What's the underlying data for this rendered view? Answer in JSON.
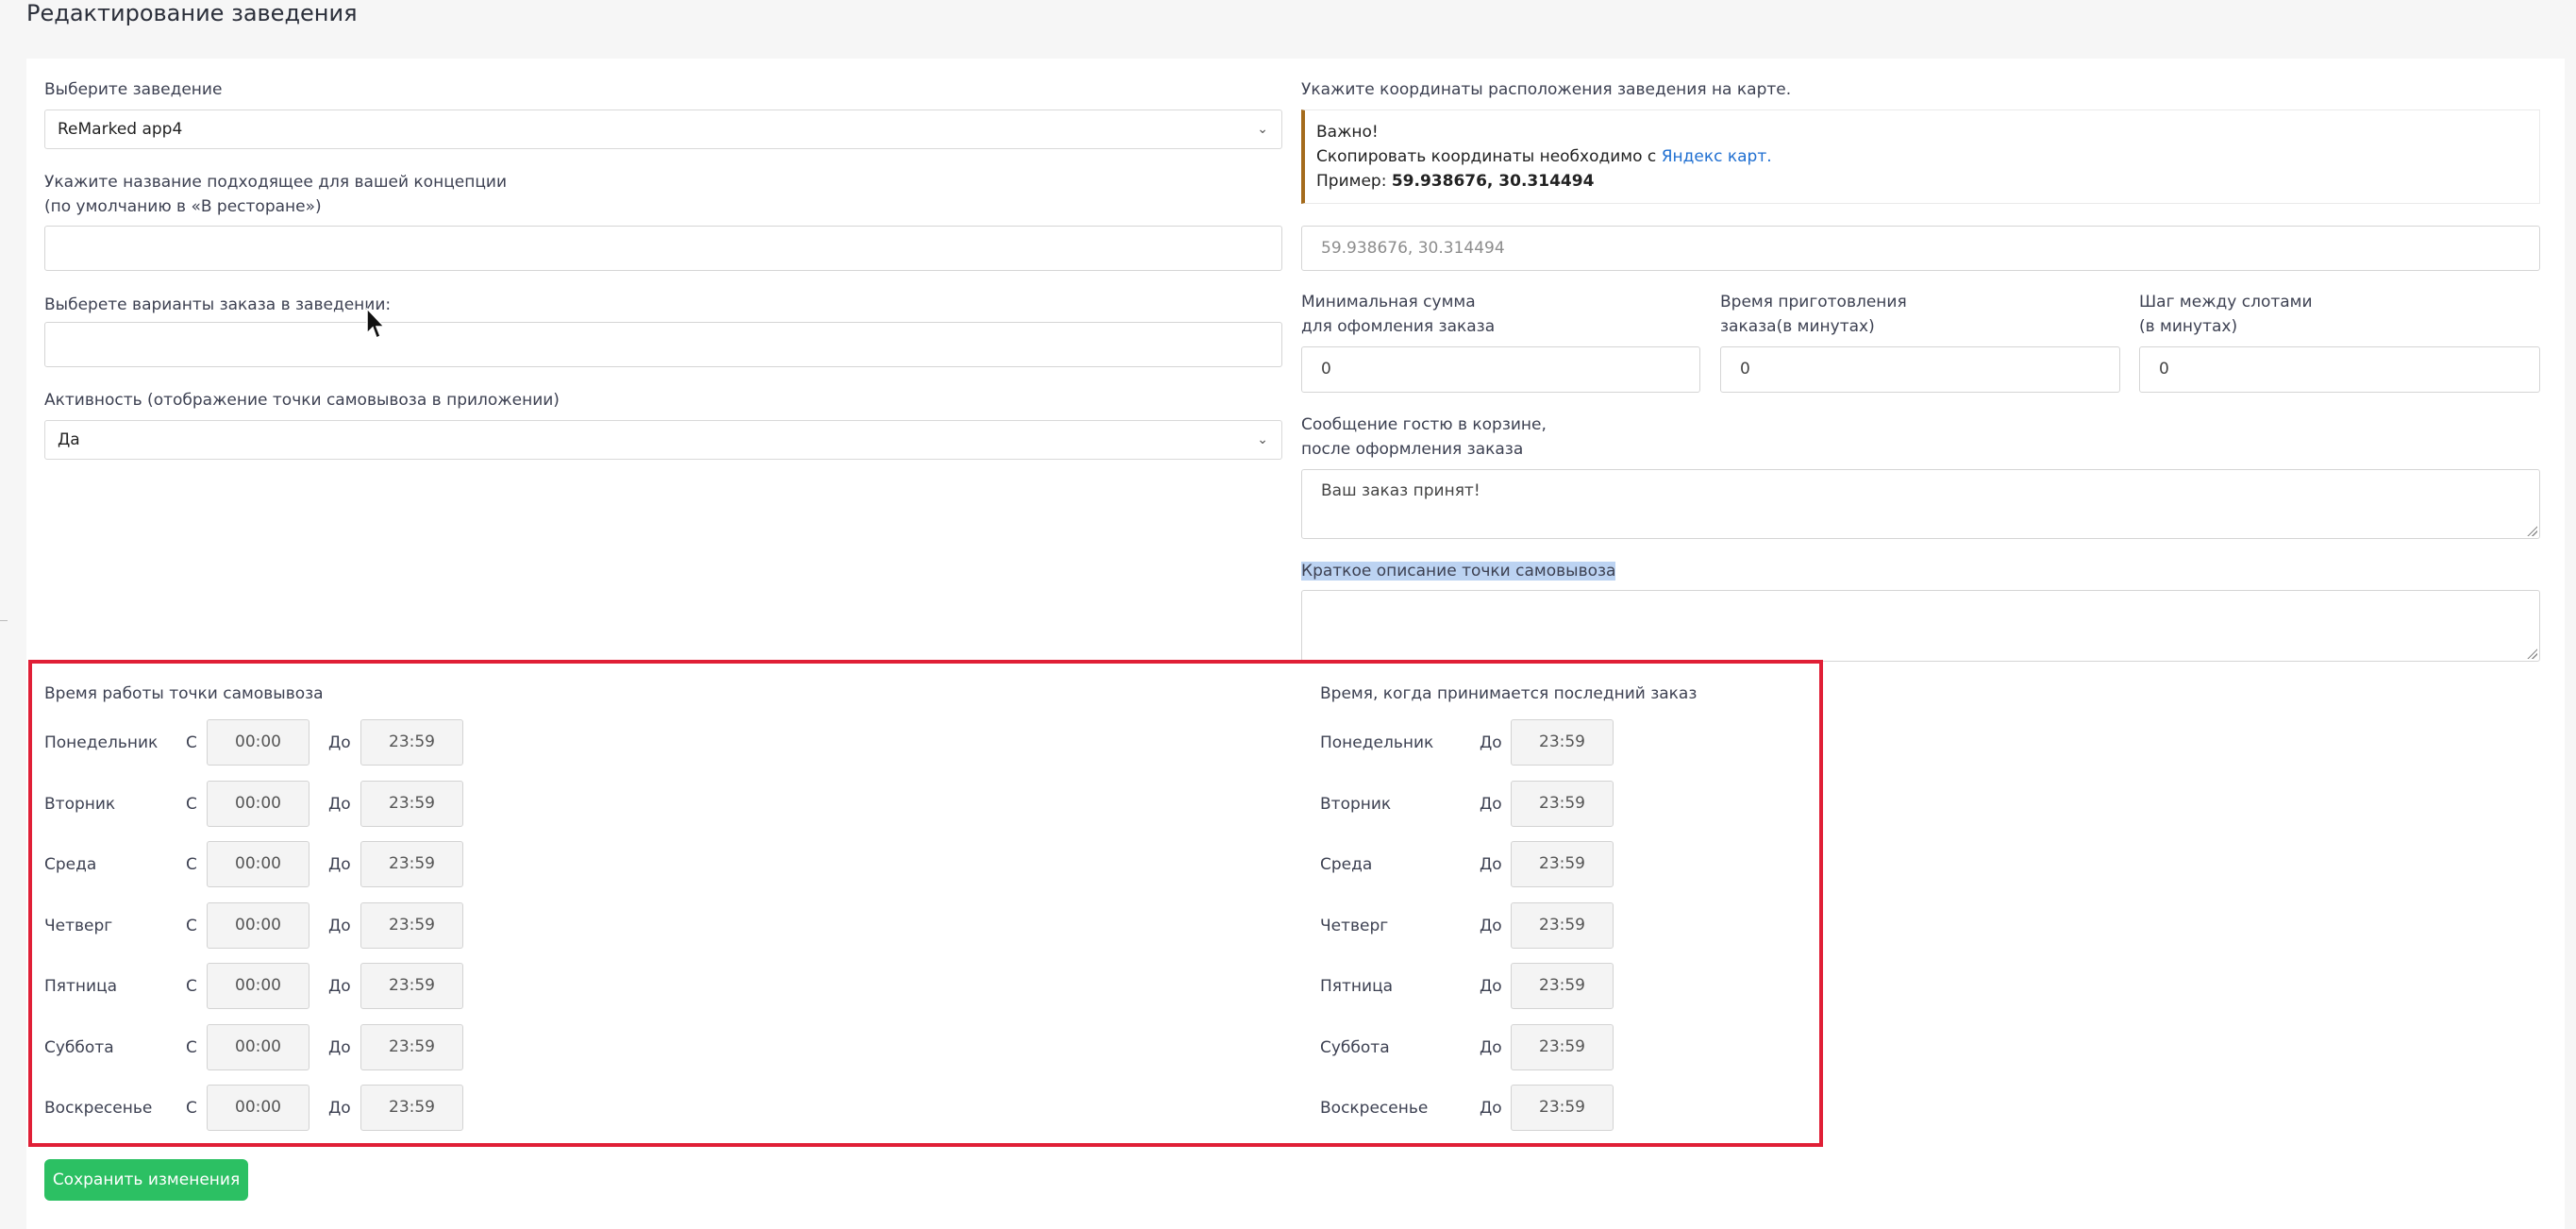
{
  "page": {
    "title": "Редактирование заведения"
  },
  "left": {
    "venue_label": "Выберите заведение",
    "venue_value": "ReMarked app4",
    "name_label": "Укажите название подходящее для вашей концепции\n(по умолчанию в «В ресторане»)",
    "name_value": "",
    "order_variants_label": "Выберете варианты заказа в заведении:",
    "order_variants_value": "",
    "activity_label": "Активность (отображение точки самовывоза в приложении)",
    "activity_value": "Да"
  },
  "right": {
    "coords_label": "Укажите координаты расположения заведения на карте.",
    "alert": {
      "line1": "Важно!",
      "line2_prefix": "Скопировать координаты необходимо с ",
      "link": "Яндекс карт.",
      "line3_prefix": "Пример: ",
      "example": "59.938676, 30.314494"
    },
    "coords_placeholder": "59.938676, 30.314494",
    "min_sum_label": "Минимальная сумма\nдля офомления заказа",
    "min_sum_value": "0",
    "prep_time_label": "Время приготовления\nзаказа(в минутах)",
    "prep_time_value": "0",
    "slot_step_label": "Шаг между слотами\n(в минутах)",
    "slot_step_value": "0",
    "message_label": "Сообщение гостю в корзине,\nпосле оформления заказа",
    "message_value": "Ваш заказ принят!",
    "description_label": "Краткое описание точки самовывоза",
    "description_value": ""
  },
  "schedule": {
    "title": "Время работы точки самовывоза",
    "from_label": "С",
    "to_label": "До",
    "last_order_title": "Время, когда принимается последний заказ",
    "days": [
      {
        "name": "Понедельник",
        "from": "00:00",
        "to": "23:59",
        "last": "23:59"
      },
      {
        "name": "Вторник",
        "from": "00:00",
        "to": "23:59",
        "last": "23:59"
      },
      {
        "name": "Среда",
        "from": "00:00",
        "to": "23:59",
        "last": "23:59"
      },
      {
        "name": "Четверг",
        "from": "00:00",
        "to": "23:59",
        "last": "23:59"
      },
      {
        "name": "Пятница",
        "from": "00:00",
        "to": "23:59",
        "last": "23:59"
      },
      {
        "name": "Суббота",
        "from": "00:00",
        "to": "23:59",
        "last": "23:59"
      },
      {
        "name": "Воскресенье",
        "from": "00:00",
        "to": "23:59",
        "last": "23:59"
      }
    ]
  },
  "actions": {
    "save_label": "Сохранить изменения"
  },
  "colors": {
    "accent_green": "#2cc063",
    "frame_red": "#e01f36",
    "link_blue": "#1f6fd1",
    "alert_border": "#a46b1c"
  }
}
